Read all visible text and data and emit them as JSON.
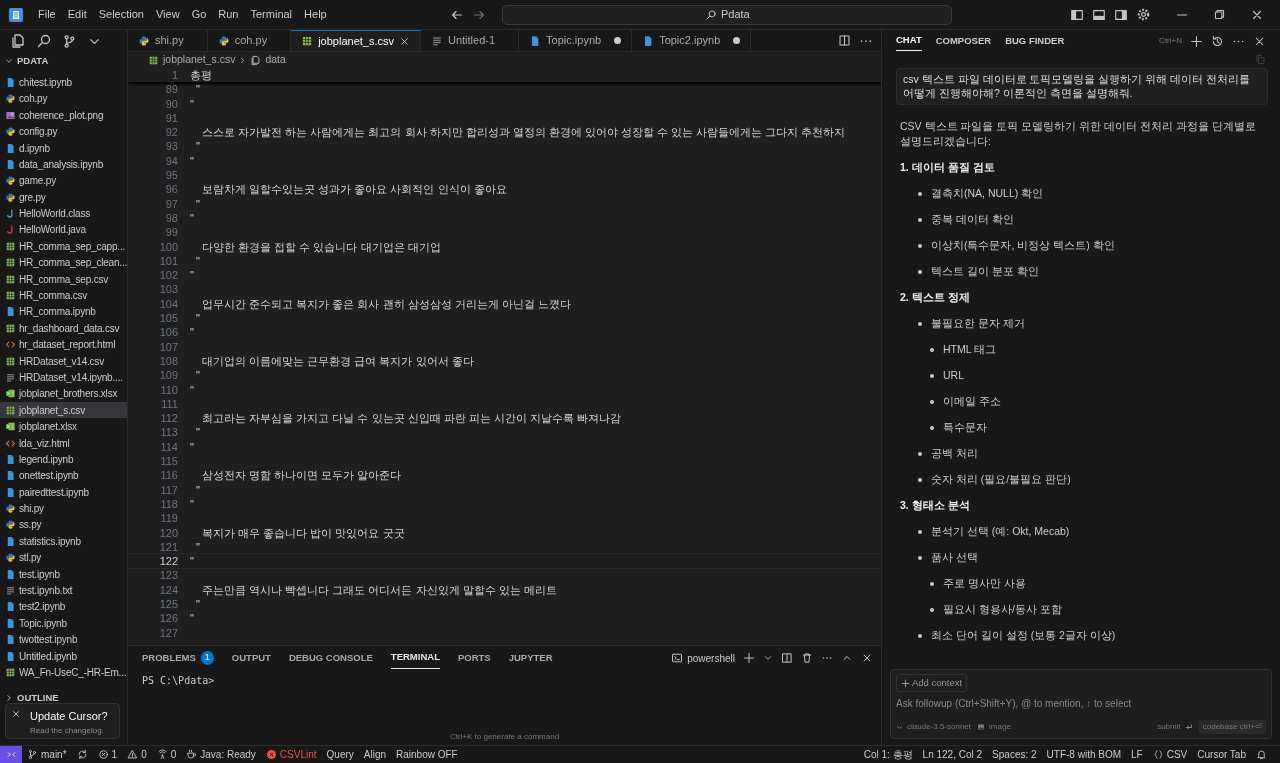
{
  "title_bar": {
    "menus": [
      "File",
      "Edit",
      "Selection",
      "View",
      "Go",
      "Run",
      "Terminal",
      "Help"
    ],
    "search": "Pdata"
  },
  "explorer": {
    "title": "PDATA",
    "files": [
      {
        "name": "chitest.ipynb",
        "kind": "ipynb",
        "selected": false
      },
      {
        "name": "coh.py",
        "kind": "py",
        "selected": false
      },
      {
        "name": "coherence_plot.png",
        "kind": "png",
        "selected": false
      },
      {
        "name": "config.py",
        "kind": "py",
        "selected": false
      },
      {
        "name": "d.ipynb",
        "kind": "ipynb",
        "selected": false
      },
      {
        "name": "data_analysis.ipynb",
        "kind": "ipynb",
        "selected": false
      },
      {
        "name": "game.py",
        "kind": "py",
        "selected": false
      },
      {
        "name": "gre.py",
        "kind": "py",
        "selected": false
      },
      {
        "name": "HelloWorld.class",
        "kind": "class",
        "selected": false
      },
      {
        "name": "HelloWorld.java",
        "kind": "java",
        "selected": false
      },
      {
        "name": "HR_comma_sep_capp...",
        "kind": "csv",
        "selected": false
      },
      {
        "name": "HR_comma_sep_clean...",
        "kind": "csv",
        "selected": false
      },
      {
        "name": "HR_comma_sep.csv",
        "kind": "csv",
        "selected": false
      },
      {
        "name": "HR_comma.csv",
        "kind": "csv",
        "selected": false
      },
      {
        "name": "HR_comma.ipynb",
        "kind": "ipynb",
        "selected": false
      },
      {
        "name": "hr_dashboard_data.csv",
        "kind": "csv",
        "selected": false
      },
      {
        "name": "hr_dataset_report.html",
        "kind": "html",
        "selected": false
      },
      {
        "name": "HRDataset_v14.csv",
        "kind": "csv",
        "selected": false
      },
      {
        "name": "HRDataset_v14.ipynb....",
        "kind": "txt",
        "selected": false
      },
      {
        "name": "jobplanet_brothers.xlsx",
        "kind": "xlsx",
        "selected": false
      },
      {
        "name": "jobplanet_s.csv",
        "kind": "csv",
        "selected": true
      },
      {
        "name": "jobplanet.xlsx",
        "kind": "xlsx",
        "selected": false
      },
      {
        "name": "lda_viz.html",
        "kind": "html",
        "selected": false
      },
      {
        "name": "legend.ipynb",
        "kind": "ipynb",
        "selected": false
      },
      {
        "name": "onettest.ipynb",
        "kind": "ipynb",
        "selected": false
      },
      {
        "name": "pairedttest.ipynb",
        "kind": "ipynb",
        "selected": false
      },
      {
        "name": "shi.py",
        "kind": "py",
        "selected": false
      },
      {
        "name": "ss.py",
        "kind": "py",
        "selected": false
      },
      {
        "name": "statistics.ipynb",
        "kind": "ipynb",
        "selected": false
      },
      {
        "name": "stl.py",
        "kind": "py",
        "selected": false
      },
      {
        "name": "test.ipynb",
        "kind": "ipynb",
        "selected": false
      },
      {
        "name": "test.ipynb.txt",
        "kind": "txt",
        "selected": false
      },
      {
        "name": "test2.ipynb",
        "kind": "ipynb",
        "selected": false
      },
      {
        "name": "Topic.ipynb",
        "kind": "ipynb",
        "selected": false
      },
      {
        "name": "twottest.ipynb",
        "kind": "ipynb",
        "selected": false
      },
      {
        "name": "Untitled.ipynb",
        "kind": "ipynb",
        "selected": false
      },
      {
        "name": "WA_Fn-UseC_-HR-Em...",
        "kind": "csv",
        "selected": false
      }
    ],
    "sections": [
      "OUTLINE"
    ]
  },
  "notification": {
    "title": "Update Cursor?",
    "text": "Read the changelog."
  },
  "editor_tabs": [
    {
      "label": "shi.py",
      "kind": "py",
      "selected": false,
      "dirty": false
    },
    {
      "label": "coh.py",
      "kind": "py",
      "selected": false,
      "dirty": false
    },
    {
      "label": "jobplanet_s.csv",
      "kind": "csv",
      "selected": true,
      "dirty": false
    },
    {
      "label": "Untitled-1",
      "kind": "txt",
      "selected": false,
      "dirty": false
    },
    {
      "label": "Topic.ipynb",
      "kind": "ipynb",
      "selected": false,
      "dirty": true
    },
    {
      "label": "Topic2.ipynb",
      "kind": "ipynb",
      "selected": false,
      "dirty": true
    }
  ],
  "breadcrumb": [
    "jobplanet_s.csv",
    "data"
  ],
  "editor": {
    "sticky": {
      "number": "1",
      "text": "총평"
    },
    "lines": [
      {
        "number": "89",
        "text": "  \"",
        "current": false
      },
      {
        "number": "90",
        "text": "\"",
        "current": false
      },
      {
        "number": "91",
        "current": false
      },
      {
        "number": "92",
        "text": "    스스로 자가발전 하는 사람에게는 최고의 회사 하지만 합리성과 열정의 환경에 있어야 성장할 수 있는 사람들에게는 그다지 추천하지",
        "current": false
      },
      {
        "number": "93",
        "text": "  \"",
        "current": false
      },
      {
        "number": "94",
        "text": "\"",
        "current": false
      },
      {
        "number": "95",
        "current": false
      },
      {
        "number": "96",
        "text": "    보람차게 일할수있는곳 성과가 좋아요 사회적인 인식이 좋아요",
        "current": false
      },
      {
        "number": "97",
        "text": "  \"",
        "current": false
      },
      {
        "number": "98",
        "text": "\"",
        "current": false
      },
      {
        "number": "99",
        "current": false
      },
      {
        "number": "100",
        "text": "    다양한 환경을 접할 수 있습니다 대기업은 대기업",
        "current": false
      },
      {
        "number": "101",
        "text": "  \"",
        "current": false
      },
      {
        "number": "102",
        "text": "\"",
        "current": false
      },
      {
        "number": "103",
        "current": false
      },
      {
        "number": "104",
        "text": "    업무시간 준수되고 복지가 좋은 회사 괜히 삼성삼성 거리는게 아닌걸 느꼈다",
        "current": false
      },
      {
        "number": "105",
        "text": "  \"",
        "current": false
      },
      {
        "number": "106",
        "text": "\"",
        "current": false
      },
      {
        "number": "107",
        "current": false
      },
      {
        "number": "108",
        "text": "    대기업의 이름에맞는 근무환경 급여 복지가 있어서 좋다",
        "current": false
      },
      {
        "number": "109",
        "text": "  \"",
        "current": false
      },
      {
        "number": "110",
        "text": "\"",
        "current": false
      },
      {
        "number": "111",
        "current": false
      },
      {
        "number": "112",
        "text": "    최고라는 자부심을 가지고 다닐 수 있는곳 신입때 파란 피는 시간이 지날수록 빠져나감",
        "current": false
      },
      {
        "number": "113",
        "text": "  \"",
        "current": false
      },
      {
        "number": "114",
        "text": "\"",
        "current": false
      },
      {
        "number": "115",
        "current": false
      },
      {
        "number": "116",
        "text": "    삼성전자 명함 하나이면 모두가 알아준다",
        "current": false
      },
      {
        "number": "117",
        "text": "  \"",
        "current": false
      },
      {
        "number": "118",
        "text": "\"",
        "current": false
      },
      {
        "number": "119",
        "current": false
      },
      {
        "number": "120",
        "text": "    복지가 매우 좋습니다 밥이 맛있어요 굿굿",
        "current": false
      },
      {
        "number": "121",
        "text": "  \"",
        "current": false
      },
      {
        "number": "122",
        "text": "\"",
        "current": true
      },
      {
        "number": "123",
        "current": false
      },
      {
        "number": "124",
        "text": "    주는만큼 역시나 빡셉니다 그래도 어디서든 자신있게 말할수 있는 메리트",
        "current": false
      },
      {
        "number": "125",
        "text": "  \"",
        "current": false
      },
      {
        "number": "126",
        "text": "\"",
        "current": false
      },
      {
        "number": "127",
        "current": false
      }
    ]
  },
  "panel": {
    "tabs": [
      {
        "label": "PROBLEMS",
        "badge": "1",
        "selected": false
      },
      {
        "label": "OUTPUT",
        "selected": false
      },
      {
        "label": "DEBUG CONSOLE",
        "selected": false
      },
      {
        "label": "TERMINAL",
        "selected": true
      },
      {
        "label": "PORTS",
        "selected": false
      },
      {
        "label": "JUPYTER",
        "selected": false
      }
    ],
    "shell": "powershell",
    "prompt": "PS C:\\Pdata>",
    "hint": "Ctrl+K to generate a command"
  },
  "chat": {
    "tabs": [
      {
        "label": "CHAT",
        "selected": true
      },
      {
        "label": "COMPOSER",
        "selected": false
      },
      {
        "label": "BUG FINDER",
        "selected": false
      }
    ],
    "shortcut": "Ctrl+N",
    "user_message": "csv 텍스트 파일 데이터로 토픽모델링을 실행하기 위해 데이터 전처리를 어떻게 진행해야해? 이론적인 측면을 설명해줘.",
    "intro": "CSV 텍스트 파일을 토픽 모델링하기 위한 데이터 전처리 과정을 단계별로 설명드리겠습니다:",
    "sections": [
      {
        "heading": "1. 데이터 품질 검토",
        "items": [
          {
            "text": "결측치(NA, NULL) 확인"
          },
          {
            "text": "중복 데이터 확인"
          },
          {
            "text": "이상치(특수문자, 비정상 텍스트) 확인"
          },
          {
            "text": "텍스트 길이 분포 확인"
          }
        ]
      },
      {
        "heading": "2. 텍스트 정제",
        "items": [
          {
            "text": "불필요한 문자 제거",
            "children": [
              {
                "text": "HTML 태그"
              },
              {
                "text": "URL"
              },
              {
                "text": "이메일 주소"
              },
              {
                "text": "특수문자"
              }
            ]
          },
          {
            "text": "공백 처리"
          },
          {
            "text": "숫자 처리 (필요/불필요 판단)"
          }
        ]
      },
      {
        "heading": "3. 형태소 분석",
        "items": [
          {
            "text": "분석기 선택 (예: Okt, Mecab)"
          },
          {
            "text": "품사 선택",
            "children": [
              {
                "text": "주로 명사만 사용"
              },
              {
                "text": "필요시 형용사/동사 포함"
              }
            ]
          },
          {
            "text": "최소 단어 길이 설정 (보통 2글자 이상)"
          }
        ]
      }
    ],
    "input": {
      "chip": "Add context",
      "placeholder": "Ask followup (Ctrl+Shift+Y), @ to mention, ↑ to select",
      "model": "claude-3.5-sonnet",
      "image": "image",
      "submit": "submit",
      "codebase": "codebase ctrl+⏎"
    }
  },
  "status_left": [
    {
      "kind": "remote"
    },
    {
      "kind": "branch",
      "text": "main*"
    },
    {
      "kind": "sync"
    },
    {
      "kind": "errors",
      "text": "1"
    },
    {
      "kind": "warnings",
      "text": "0"
    },
    {
      "kind": "ports",
      "text": "0"
    },
    {
      "kind": "java",
      "text": "Java: Ready"
    },
    {
      "kind": "lint",
      "text": "CSVLint",
      "color": "#f14c4c"
    },
    {
      "kind": "plain",
      "text": "Query"
    },
    {
      "kind": "plain",
      "text": "Align"
    },
    {
      "kind": "plain",
      "text": "Rainbow OFF"
    }
  ],
  "status_right": [
    {
      "kind": "plain",
      "text": "Col 1: 총평"
    },
    {
      "kind": "plain",
      "text": "Ln 122, Col 2"
    },
    {
      "kind": "plain",
      "text": "Spaces: 2"
    },
    {
      "kind": "plain",
      "text": "UTF-8 with BOM"
    },
    {
      "kind": "plain",
      "text": "LF"
    },
    {
      "kind": "language",
      "text": "CSV"
    },
    {
      "kind": "plain",
      "text": "Cursor Tab"
    },
    {
      "kind": "bell"
    }
  ]
}
